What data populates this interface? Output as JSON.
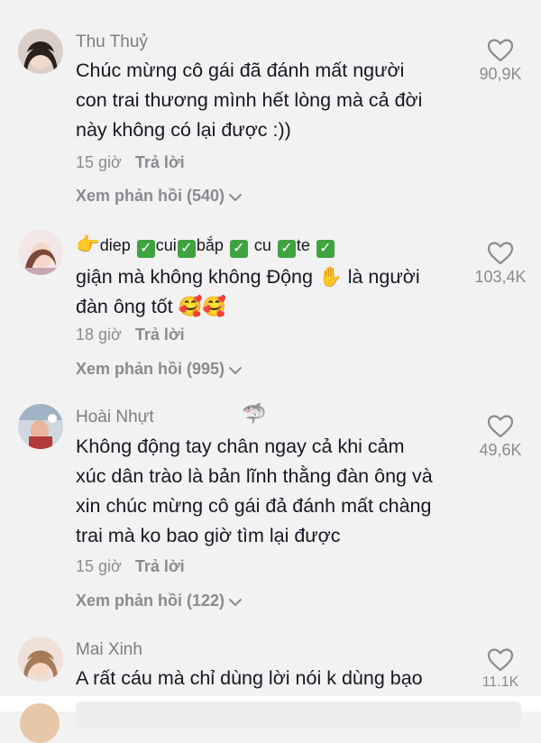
{
  "comments": [
    {
      "author": "Thu Thuỷ",
      "lines": [
        "Chúc mừng cô gái đã đánh mất người",
        "con trai thương mình hết lòng mà cả đời",
        "này không có lại được :))"
      ],
      "time": "15 giờ",
      "reply_label": "Trả lời",
      "view_replies": "Xem phản hồi (540)",
      "likes": "90,9K"
    },
    {
      "author": "",
      "line1_parts": [
        "diep",
        "cui",
        "bắp",
        "cu",
        "te"
      ],
      "line2_start": "giận mà không không Động",
      "line2_end": "là người",
      "line3": "đàn ông tốt",
      "pointing_emoji": "👉",
      "hand_emoji": "✋",
      "smile_emojis": "🥰🥰",
      "check_glyph": "✓",
      "time": "18 giờ",
      "reply_label": "Trả lời",
      "view_replies": "Xem phản hồi (995)",
      "likes": "103,4K"
    },
    {
      "author": "Hoài Nhựt",
      "shark_emoji": "🦈",
      "lines": [
        "Không động tay chân ngay cả khi cảm",
        "xúc dân trào là bản lĩnh thằng đàn ông và",
        "xin chúc mừng cô gái đả đánh mất chàng",
        "trai mà ko bao giờ tìm lại được"
      ],
      "time": "15 giờ",
      "reply_label": "Trả lời",
      "view_replies": "Xem phản hồi (122)",
      "likes": "49,6K"
    },
    {
      "author": "Mai Xinh",
      "lines": [
        "A rất cáu mà chỉ dùng lời nói k dùng bạo"
      ],
      "likes": "11.1K"
    }
  ],
  "colors": {
    "background": "#f2f2f2",
    "text": "#161823",
    "muted": "#8a8b91",
    "check_green": "#3fa33f"
  }
}
